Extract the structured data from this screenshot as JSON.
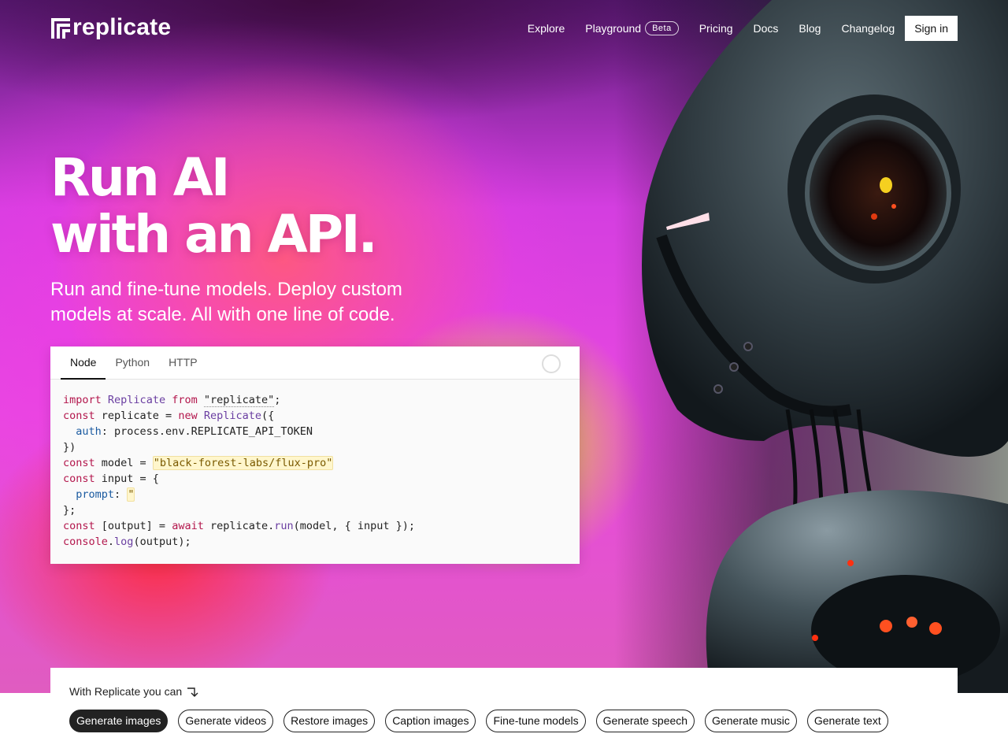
{
  "nav": {
    "logo_text": "replicate",
    "links": [
      {
        "label": "Explore"
      },
      {
        "label": "Playground",
        "badge": "Beta"
      },
      {
        "label": "Pricing"
      },
      {
        "label": "Docs"
      },
      {
        "label": "Blog"
      },
      {
        "label": "Changelog"
      }
    ],
    "signin_label": "Sign in"
  },
  "hero": {
    "headline_line1": "Run AI",
    "headline_line2": "with an API.",
    "subhead": "Run and fine-tune models. Deploy custom models at scale. All with one line of code."
  },
  "code_card": {
    "tabs": [
      "Node",
      "Python",
      "HTTP"
    ],
    "active_tab": "Node",
    "copy_icon": "copy-icon"
  },
  "bottom": {
    "label": "With Replicate you can",
    "arrow_icon": "arrow-down-right-icon",
    "pills": [
      "Generate images",
      "Generate videos",
      "Restore images",
      "Caption images",
      "Fine-tune models",
      "Generate speech",
      "Generate music",
      "Generate text"
    ],
    "active_pill": "Generate images"
  },
  "colors": {
    "accent_dark": "#222222",
    "hero_magenta": "#e848e0"
  }
}
